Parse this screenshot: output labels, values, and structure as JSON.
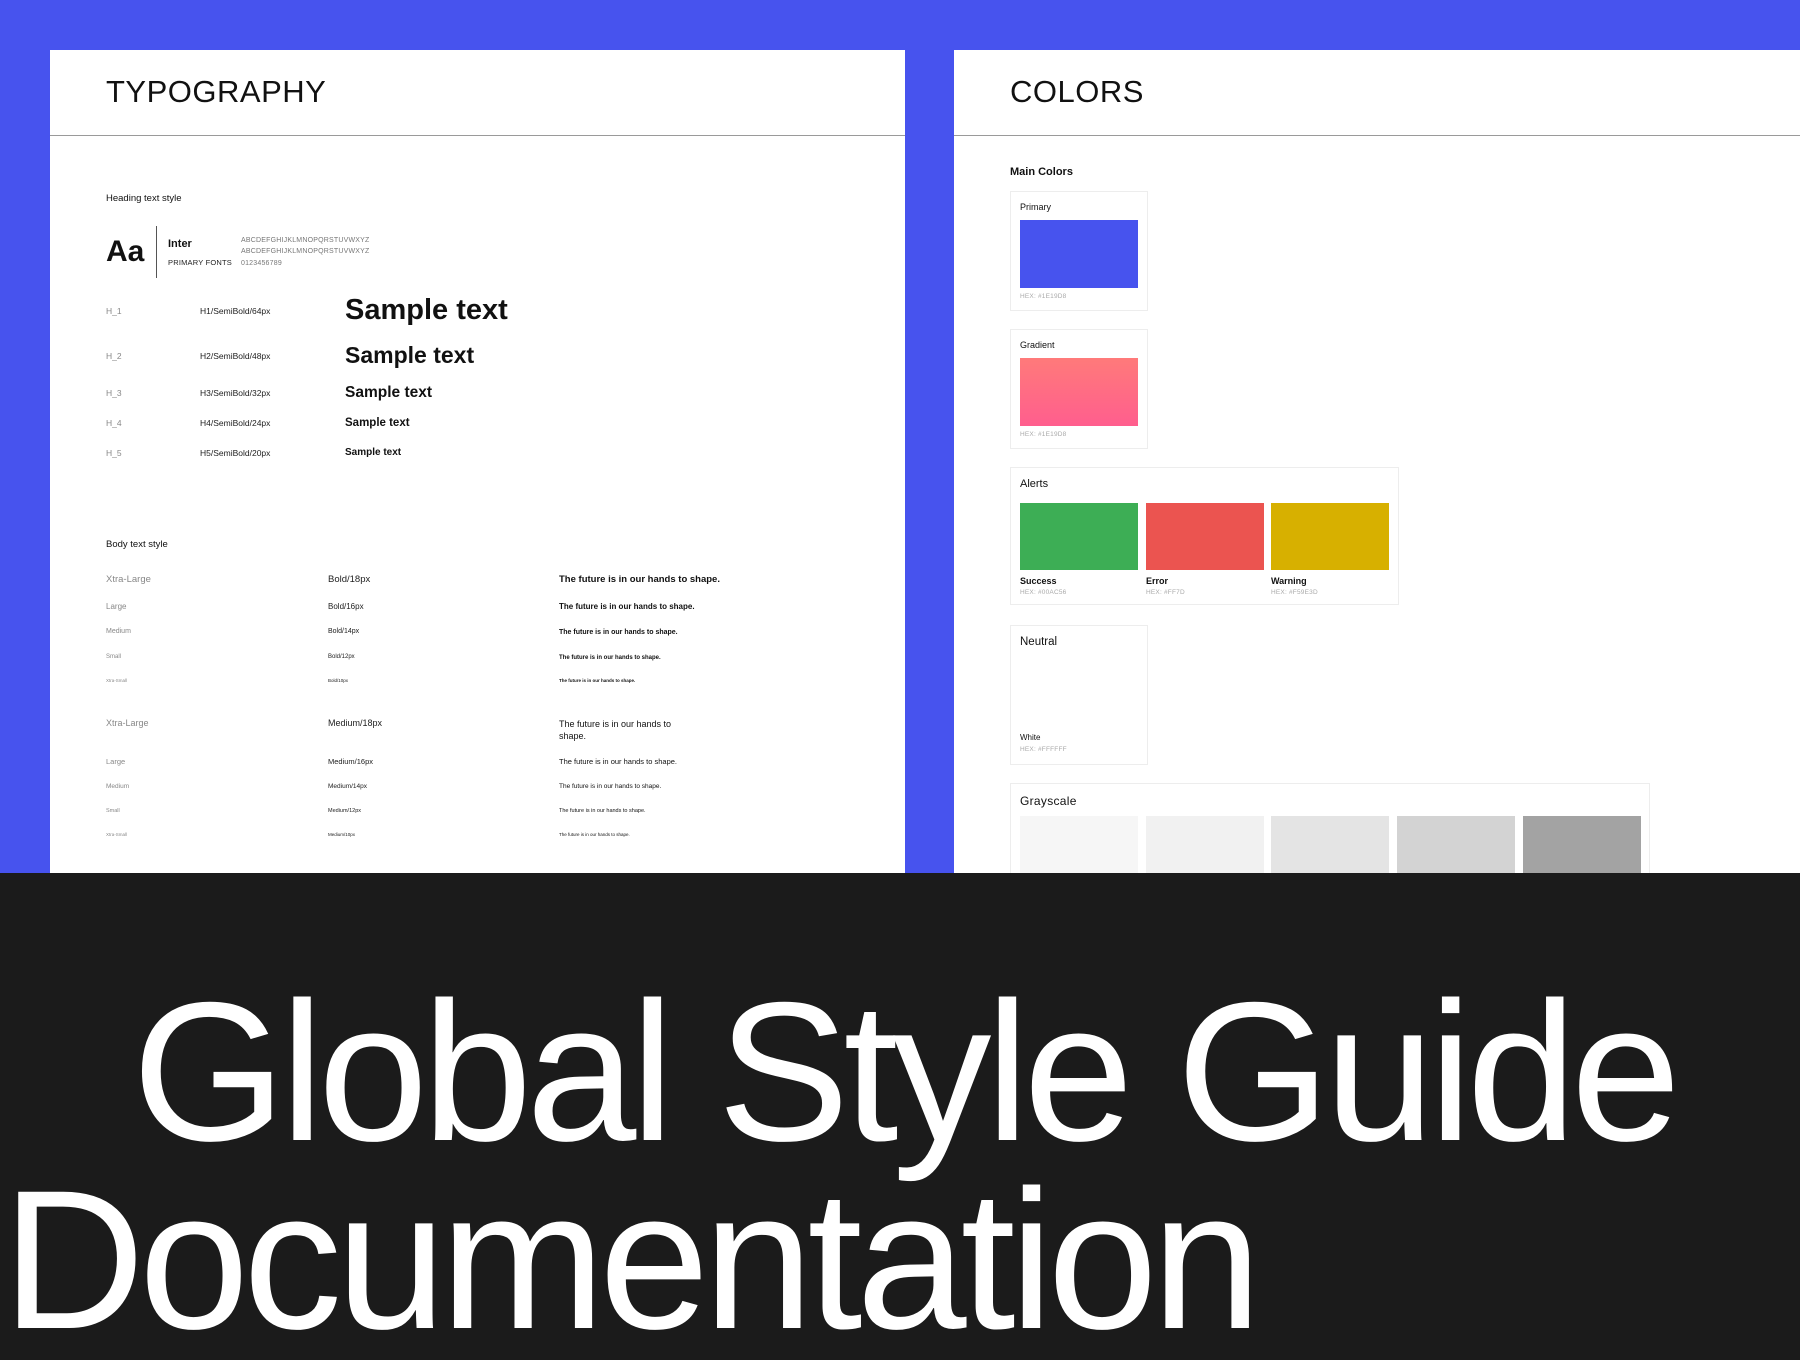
{
  "typography": {
    "title": "TYPOGRAPHY",
    "heading_label": "Heading text style",
    "font": {
      "specimen": "Aa",
      "name": "Inter",
      "role": "PRIMARY FONTS",
      "uppercase": "ABCDEFGHIJKLMNOPQRSTUVWXYZ",
      "lowercase": "ABCDEFGHIJKLMNOPQRSTUVWXYZ",
      "digits": "0123456789"
    },
    "headings": [
      {
        "id": "H_1",
        "spec": "H1/SemiBold/64px",
        "sample": "Sample text"
      },
      {
        "id": "H_2",
        "spec": "H2/SemiBold/48px",
        "sample": "Sample text"
      },
      {
        "id": "H_3",
        "spec": "H3/SemiBold/32px",
        "sample": "Sample text"
      },
      {
        "id": "H_4",
        "spec": "H4/SemiBold/24px",
        "sample": "Sample text"
      },
      {
        "id": "H_5",
        "spec": "H5/SemiBold/20px",
        "sample": "Sample text"
      }
    ],
    "body_label": "Body text style",
    "body_bold": [
      {
        "size": "Xtra-Large",
        "spec": "Bold/18px",
        "sample": "The future is in our hands to shape."
      },
      {
        "size": "Large",
        "spec": "Bold/16px",
        "sample": "The future is in our hands to shape."
      },
      {
        "size": "Medium",
        "spec": "Bold/14px",
        "sample": "The future is in our hands to shape."
      },
      {
        "size": "Small",
        "spec": "Bold/12px",
        "sample": "The future is in our hands to shape."
      },
      {
        "size": "Xtra-Small",
        "spec": "Bold/10px",
        "sample": "The future is in our hands to shape."
      }
    ],
    "body_medium": [
      {
        "size": "Xtra-Large",
        "spec": "Medium/18px",
        "sample": "The future is in our hands to shape."
      },
      {
        "size": "Large",
        "spec": "Medium/16px",
        "sample": "The future is in our hands to shape."
      },
      {
        "size": "Medium",
        "spec": "Medium/14px",
        "sample": "The future is in our hands to shape."
      },
      {
        "size": "Small",
        "spec": "Medium/12px",
        "sample": "The future is in our hands to shape."
      },
      {
        "size": "Xtra-Small",
        "spec": "Medium/10px",
        "sample": "The future is in our hands to shape."
      }
    ]
  },
  "colors": {
    "title": "COLORS",
    "main_label": "Main Colors",
    "primary": {
      "label": "Primary",
      "hex": "HEX: #1E19D8",
      "color": "#4753EE"
    },
    "gradient": {
      "label": "Gradient",
      "hex": "HEX: #1E19D8",
      "color_top": "#FF7A7A",
      "color_bottom": "#FF5E8E"
    },
    "alerts": {
      "label": "Alerts",
      "items": [
        {
          "name": "Success",
          "hex": "HEX: #00AC56",
          "color": "#3DAE55"
        },
        {
          "name": "Error",
          "hex": "HEX: #FF7D",
          "color": "#EB5450"
        },
        {
          "name": "Warning",
          "hex": "HEX: #F59E3D",
          "color": "#D7B000"
        }
      ]
    },
    "neutral": {
      "label": "Neutral",
      "name": "White",
      "hex": "HEX: #FFFFFF",
      "color": "#FFFFFF"
    },
    "grayscale": {
      "label": "Grayscale",
      "colors": [
        "#F6F6F6",
        "#F1F1F1",
        "#E4E4E4",
        "#D3D3D3",
        "#A3A3A3"
      ]
    }
  },
  "banner": {
    "line1": "Global Style Guide",
    "line2": "Documentation"
  }
}
